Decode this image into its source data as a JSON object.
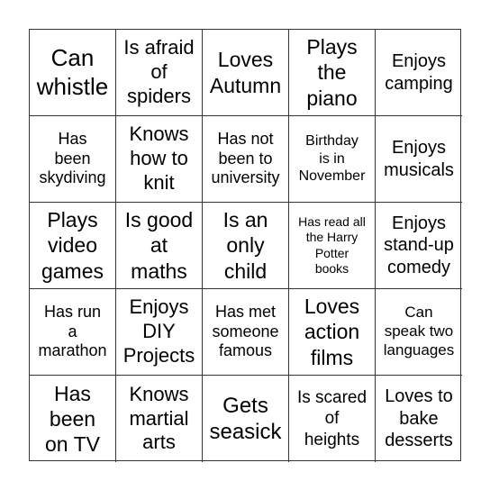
{
  "card": {
    "cells": [
      "Can\nwhistle",
      "Is afraid\nof\nspiders",
      "Loves\nAutumn",
      "Plays\nthe\npiano",
      "Enjoys\ncamping",
      "Has\nbeen\nskydiving",
      "Knows\nhow to\nknit",
      "Has not\nbeen to\nuniversity",
      "Birthday\nis in\nNovember",
      "Enjoys\nmusicals",
      "Plays\nvideo\ngames",
      "Is good\nat\nmaths",
      "Is an\nonly\nchild",
      "Has read all\nthe Harry\nPotter\nbooks",
      "Enjoys\nstand-up\ncomedy",
      "Has run\na\nmarathon",
      "Enjoys\nDIY\nProjects",
      "Has met\nsomeone\nfamous",
      "Loves\naction\nfilms",
      "Can\nspeak two\nlanguages",
      "Has\nbeen\non TV",
      "Knows\nmartial\narts",
      "Gets\nseasick",
      "Is scared\nof\nheights",
      "Loves to\nbake\ndesserts"
    ]
  }
}
